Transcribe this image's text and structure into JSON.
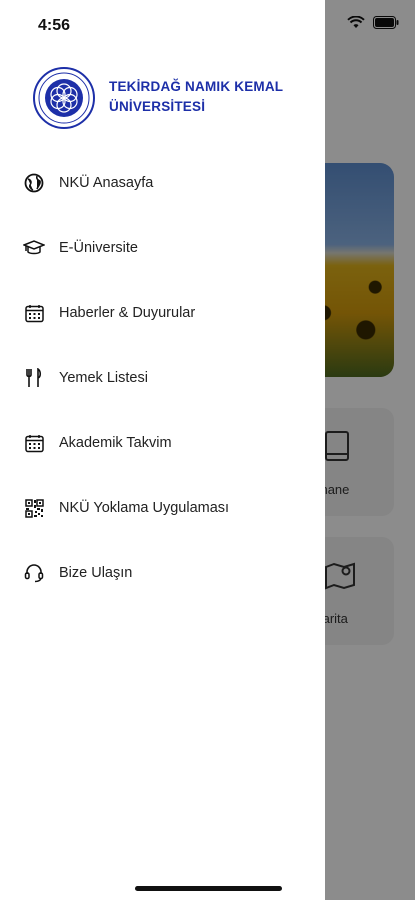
{
  "status_bar": {
    "time": "4:56"
  },
  "drawer": {
    "university_name_line1": "TEKİRDAĞ NAMIK KEMAL",
    "university_name_line2": "ÜNİVERSİTESİ",
    "menu_items": [
      {
        "label": "NKÜ Anasayfa",
        "icon": "globe-icon"
      },
      {
        "label": "E-Üniversite",
        "icon": "graduation-cap-icon"
      },
      {
        "label": "Haberler & Duyurular",
        "icon": "calendar-icon"
      },
      {
        "label": "Yemek Listesi",
        "icon": "fork-knife-icon"
      },
      {
        "label": "Akademik Takvim",
        "icon": "calendar-icon"
      },
      {
        "label": "NKÜ Yoklama Uygulaması",
        "icon": "qr-code-icon"
      },
      {
        "label": "Bize Ulaşın",
        "icon": "headset-icon"
      }
    ]
  },
  "background": {
    "tile_library_label": "üphane",
    "tile_map_label": "ı Harita"
  },
  "colors": {
    "brand": "#1d2fa8",
    "overlay": "rgba(0,0,0,0.45)"
  }
}
